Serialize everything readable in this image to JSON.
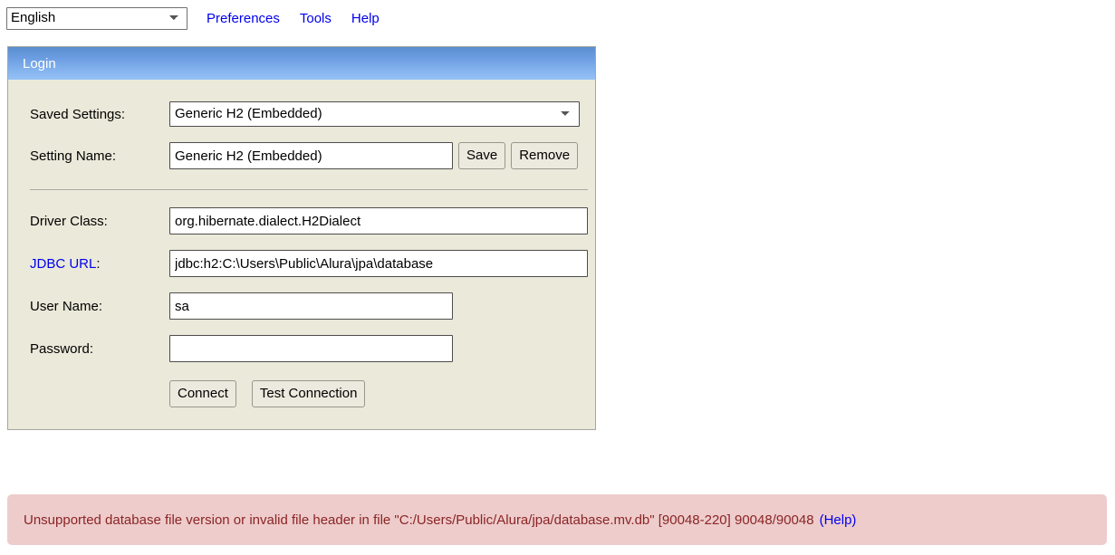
{
  "toolbar": {
    "language_selected": "English",
    "language_options": [
      "English"
    ],
    "links": [
      {
        "label": "Preferences",
        "name": "preferences-link"
      },
      {
        "label": "Tools",
        "name": "tools-link"
      },
      {
        "label": "Help",
        "name": "help-link"
      }
    ]
  },
  "login_panel": {
    "title": "Login",
    "saved_settings": {
      "label": "Saved Settings:",
      "selected": "Generic H2 (Embedded)",
      "options": [
        "Generic H2 (Embedded)"
      ]
    },
    "setting_name": {
      "label": "Setting Name:",
      "value": "Generic H2 (Embedded)",
      "save_label": "Save",
      "remove_label": "Remove"
    },
    "driver_class": {
      "label": "Driver Class:",
      "value": "org.hibernate.dialect.H2Dialect"
    },
    "jdbc_url": {
      "label": "JDBC URL",
      "label_suffix": ":",
      "value": "jdbc:h2:C:\\Users\\Public\\Alura\\jpa\\database"
    },
    "user_name": {
      "label": "User Name:",
      "value": "sa"
    },
    "password": {
      "label": "Password:",
      "value": ""
    },
    "connect_label": "Connect",
    "test_connection_label": "Test Connection"
  },
  "error": {
    "message": "Unsupported database file version or invalid file header in file \"C:/Users/Public/Alura/jpa/database.mv.db\" [90048-220] 90048/90048",
    "help_label": "(Help)"
  },
  "colors": {
    "header_gradient_top": "#5a8ed0",
    "header_gradient_bottom": "#95c2f5",
    "panel_background": "#eae9da",
    "link": "#0000ee",
    "error_background": "#eecccc",
    "error_text": "#8b2424"
  }
}
